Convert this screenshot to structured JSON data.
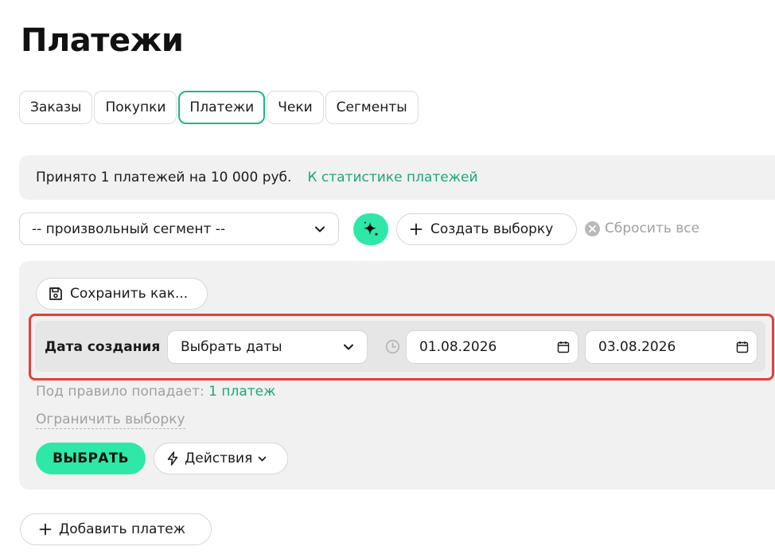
{
  "page": {
    "title": "Платежи"
  },
  "tabs": [
    {
      "label": "Заказы",
      "active": false
    },
    {
      "label": "Покупки",
      "active": false
    },
    {
      "label": "Платежи",
      "active": true
    },
    {
      "label": "Чеки",
      "active": false
    },
    {
      "label": "Сегменты",
      "active": false
    }
  ],
  "summary": {
    "text": "Принято 1 платежей на 10 000 руб.",
    "stats_link": "К статистике платежей"
  },
  "toolbar": {
    "segment_value": "-- произвольный сегмент --",
    "create_label": "Создать выборку",
    "reset_label": "Сбросить все"
  },
  "filter": {
    "save_label": "Сохранить как...",
    "rule": {
      "label": "Дата создания",
      "mode_value": "Выбрать даты",
      "date_from": "01.08.2026",
      "date_to": "03.08.2026"
    },
    "match_prefix": "Под правило попадает:",
    "match_count": "1 платеж",
    "limit_label": "Ограничить выборку",
    "select_label": "ВЫБРАТЬ",
    "actions_label": "Действия"
  },
  "footer": {
    "add_label": "Добавить платеж"
  },
  "colors": {
    "accent": "#2ee8a8",
    "link": "#1fa57d",
    "active_tab_border": "#1fb58a",
    "highlight": "#e0413a",
    "panel_bg": "#f1f1f1"
  },
  "icons": {
    "segment_chevron": "chevron-down-icon",
    "magic": "sparkles-icon",
    "create": "plus-icon",
    "reset": "close-circle-icon",
    "save": "floppy-disk-icon",
    "clock": "clock-icon",
    "calendar": "calendar-icon",
    "actions": "lightning-icon",
    "add": "plus-icon"
  }
}
